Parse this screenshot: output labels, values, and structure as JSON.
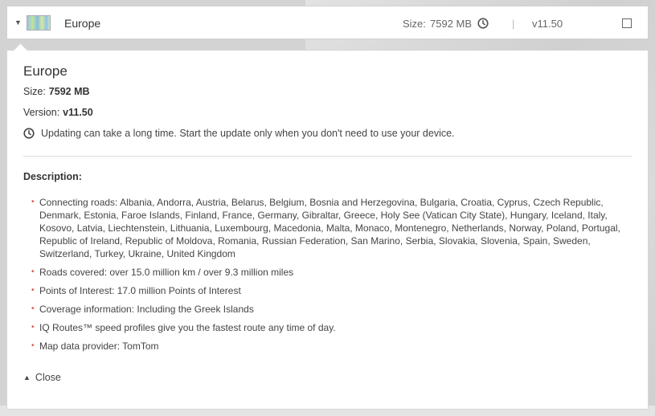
{
  "row": {
    "title": "Europe",
    "size_label": "Size:",
    "size_value": "7592 MB",
    "separator": "|",
    "version_value": "v11.50"
  },
  "panel": {
    "title": "Europe",
    "size_label": "Size:",
    "size_value": "7592 MB",
    "version_label": "Version:",
    "version_value": "v11.50",
    "warning": "Updating can take a long time. Start the update only when you don't need to use your device.",
    "description_label": "Description:",
    "description_items": [
      "Connecting roads: Albania, Andorra, Austria, Belarus, Belgium, Bosnia and Herzegovina, Bulgaria, Croatia, Cyprus, Czech Republic, Denmark, Estonia, Faroe Islands, Finland, France, Germany, Gibraltar, Greece, Holy See (Vatican City State), Hungary, Iceland, Italy, Kosovo, Latvia, Liechtenstein, Lithuania, Luxembourg, Macedonia, Malta, Monaco, Montenegro, Netherlands, Norway, Poland, Portugal, Republic of Ireland, Republic of Moldova, Romania, Russian Federation, San Marino, Serbia, Slovakia, Slovenia, Spain, Sweden, Switzerland, Turkey, Ukraine, United Kingdom",
      "Roads covered: over 15.0 million km / over 9.3 million miles",
      "Points of Interest: 17.0 million Points of Interest",
      "Coverage information: Including the Greek Islands",
      "IQ Routes™ speed profiles give you the fastest route any time of day.",
      "Map data provider: TomTom"
    ],
    "close_label": "Close"
  },
  "icons": {
    "expand": "caret-down-icon",
    "clock": "clock-icon",
    "collapse": "caret-up-icon"
  }
}
